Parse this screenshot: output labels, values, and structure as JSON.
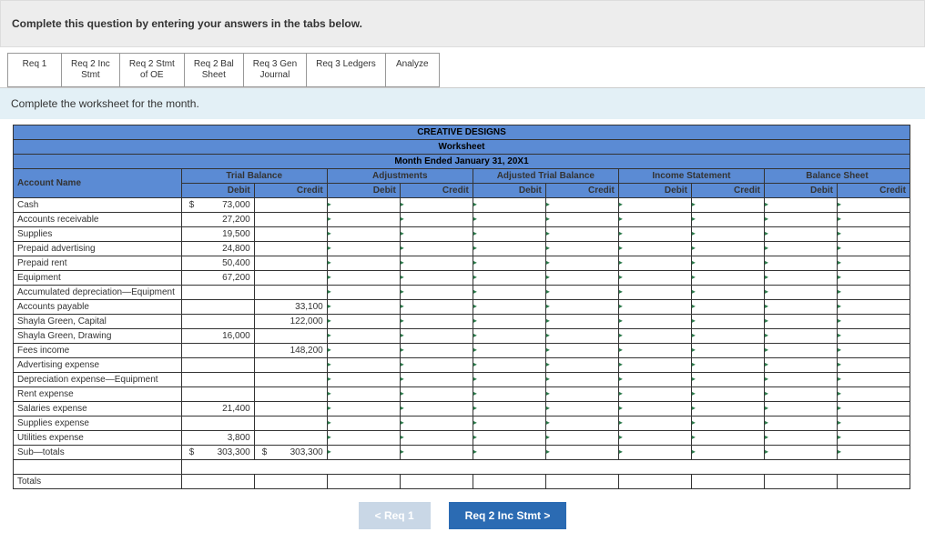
{
  "instruction": "Complete this question by entering your answers in the tabs below.",
  "tabs": [
    "Req 1",
    "Req 2 Inc Stmt",
    "Req 2 Stmt of OE",
    "Req 2 Bal Sheet",
    "Req 3 Gen Journal",
    "Req 3 Ledgers",
    "Analyze"
  ],
  "subinstruction": "Complete the worksheet for the month.",
  "title1": "CREATIVE DESIGNS",
  "title2": "Worksheet",
  "title3": "Month Ended January 31, 20X1",
  "colgroups": [
    "Trial Balance",
    "Adjustments",
    "Adjusted Trial Balance",
    "Income Statement",
    "Balance Sheet"
  ],
  "account_label": "Account Name",
  "dc": {
    "d": "Debit",
    "c": "Credit"
  },
  "rows": [
    {
      "name": "Cash",
      "tb_d": "73,000",
      "dollar": true
    },
    {
      "name": "Accounts receivable",
      "tb_d": "27,200"
    },
    {
      "name": "Supplies",
      "tb_d": "19,500"
    },
    {
      "name": "Prepaid advertising",
      "tb_d": "24,800"
    },
    {
      "name": "Prepaid rent",
      "tb_d": "50,400"
    },
    {
      "name": "Equipment",
      "tb_d": "67,200"
    },
    {
      "name": "Accumulated depreciation—Equipment"
    },
    {
      "name": "Accounts payable",
      "tb_c": "33,100"
    },
    {
      "name": "Shayla Green, Capital",
      "tb_c": "122,000"
    },
    {
      "name": "Shayla Green, Drawing",
      "tb_d": "16,000"
    },
    {
      "name": "Fees income",
      "tb_c": "148,200"
    },
    {
      "name": "Advertising expense"
    },
    {
      "name": "Depreciation expense—Equipment"
    },
    {
      "name": "Rent expense"
    },
    {
      "name": "Salaries expense",
      "tb_d": "21,400"
    },
    {
      "name": "Supplies expense"
    },
    {
      "name": "Utilities expense",
      "tb_d": "3,800"
    },
    {
      "name": "Sub—totals",
      "tb_d": "303,300",
      "tb_c": "303,300",
      "dollar": true,
      "dollar_c": true
    }
  ],
  "totals_label": "Totals",
  "nav": {
    "prev": "<  Req 1",
    "next": "Req 2 Inc Stmt  >"
  }
}
